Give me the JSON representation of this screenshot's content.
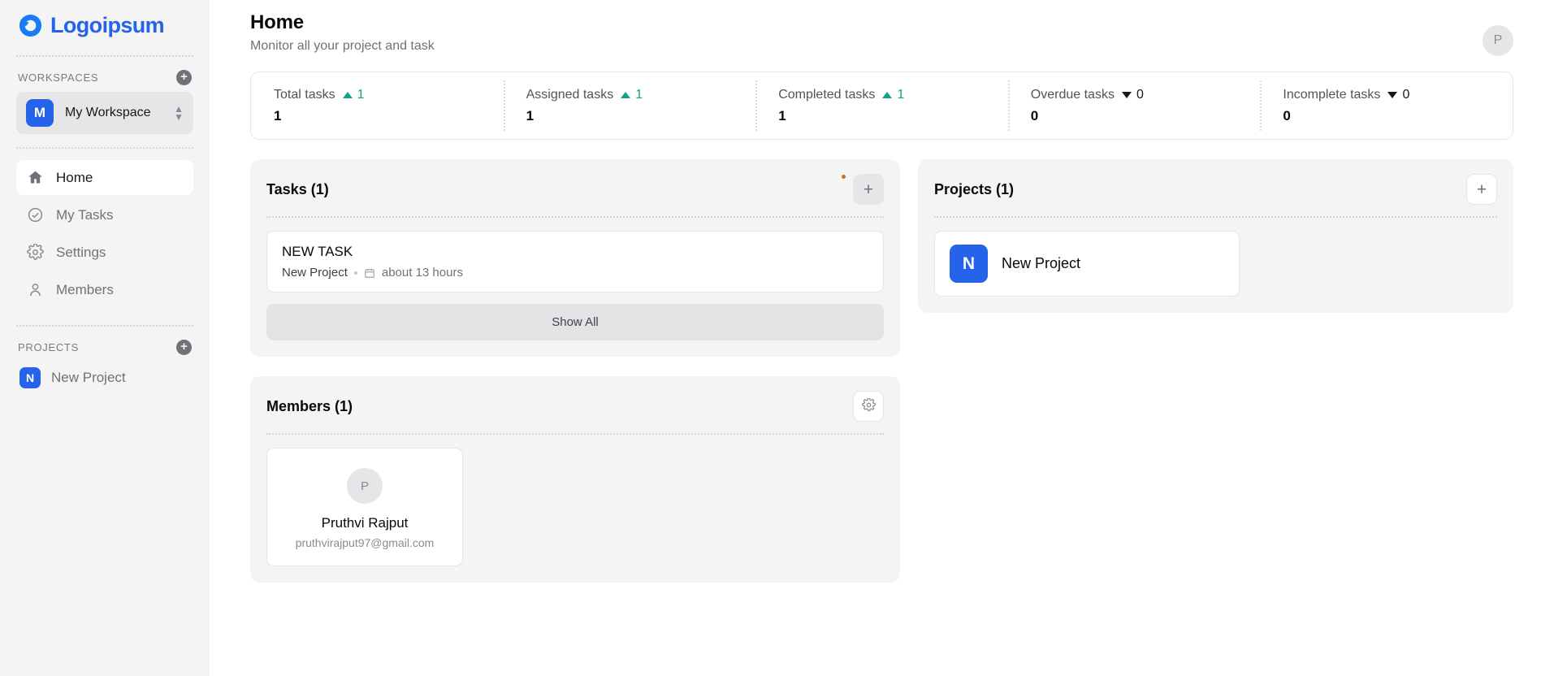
{
  "brand": {
    "name": "Logoipsum",
    "color": "#2563eb",
    "logo_icon": "logo-ring-icon"
  },
  "sidebar": {
    "workspaces_section": {
      "title": "WORKSPACES",
      "add_icon": "plus-circle-icon"
    },
    "workspace": {
      "initial": "M",
      "name": "My Workspace",
      "chevron_icon": "chevron-up-down-icon"
    },
    "nav": [
      {
        "label": "Home",
        "icon": "home-icon",
        "active": true
      },
      {
        "label": "My Tasks",
        "icon": "check-circle-icon",
        "active": false
      },
      {
        "label": "Settings",
        "icon": "gear-icon",
        "active": false
      },
      {
        "label": "Members",
        "icon": "user-icon",
        "active": false
      }
    ],
    "projects_section": {
      "title": "PROJECTS",
      "add_icon": "plus-circle-icon"
    },
    "projects": [
      {
        "initial": "N",
        "label": "New Project"
      }
    ]
  },
  "header": {
    "title": "Home",
    "subtitle": "Monitor all your project and task",
    "avatar_initial": "P"
  },
  "stats": [
    {
      "label": "Total tasks",
      "delta": "1",
      "direction": "up",
      "value": "1"
    },
    {
      "label": "Assigned tasks",
      "delta": "1",
      "direction": "up",
      "value": "1"
    },
    {
      "label": "Completed tasks",
      "delta": "1",
      "direction": "up",
      "value": "1"
    },
    {
      "label": "Overdue tasks",
      "delta": "0",
      "direction": "down",
      "value": "0"
    },
    {
      "label": "Incomplete tasks",
      "delta": "0",
      "direction": "down",
      "value": "0"
    }
  ],
  "tasks_panel": {
    "title": "Tasks (1)",
    "add_icon": "plus-icon",
    "has_notification_dot": true,
    "notification_color": "#d4700f",
    "show_all_label": "Show All",
    "tasks": [
      {
        "title": "NEW TASK",
        "project": "New Project",
        "date_icon": "calendar-icon",
        "due": "about 13 hours"
      }
    ]
  },
  "projects_panel": {
    "title": "Projects (1)",
    "add_icon": "plus-icon",
    "projects": [
      {
        "initial": "N",
        "name": "New Project"
      }
    ]
  },
  "members_panel": {
    "title": "Members (1)",
    "settings_icon": "gear-icon",
    "members": [
      {
        "initial": "P",
        "name": "Pruthvi Rajput",
        "email": "pruthvirajput97@gmail.com"
      }
    ]
  }
}
